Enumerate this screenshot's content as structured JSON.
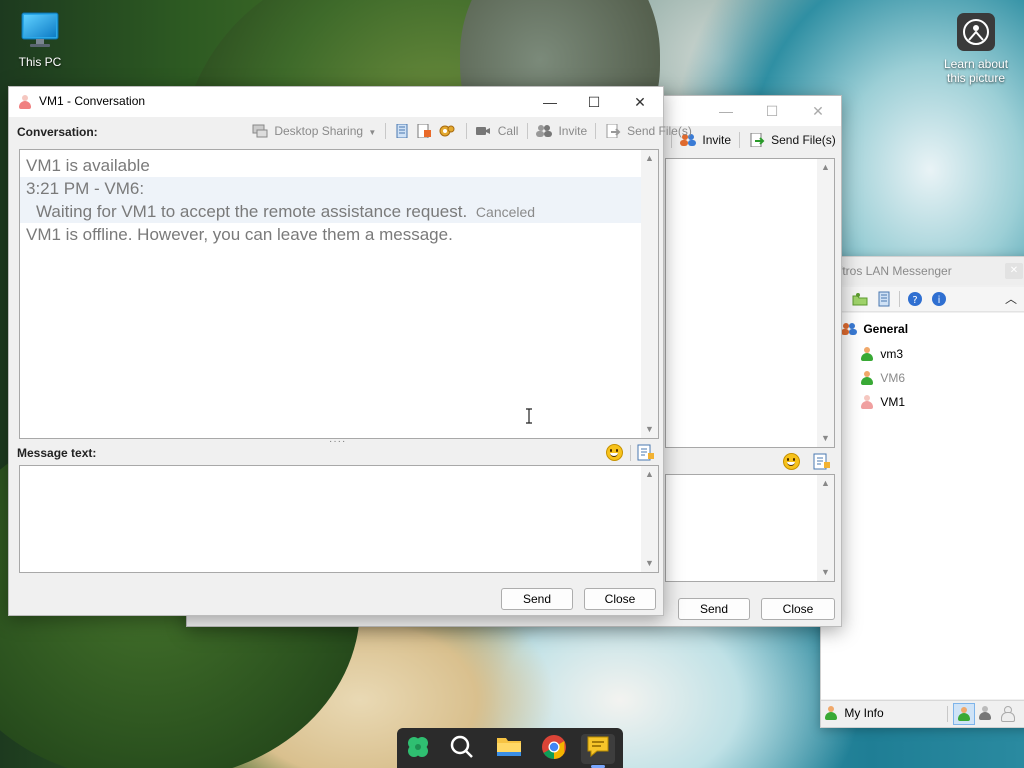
{
  "desktop": {
    "this_pc_label": "This PC",
    "learn_label_line1": "Learn about",
    "learn_label_line2": "this picture",
    "my_info_label": "My Info"
  },
  "conv_window": {
    "title": "VM1 - Conversation",
    "conversation_label": "Conversation:",
    "toolbar": {
      "desktop_sharing": "Desktop Sharing",
      "call": "Call",
      "invite": "Invite",
      "send_files": "Send File(s)"
    },
    "messages": [
      {
        "text": "VM1 is available"
      },
      {
        "text": "3:21 PM - VM6:"
      },
      {
        "text": "Waiting for VM1 to accept the remote assistance request.",
        "status": "Canceled"
      },
      {
        "text": "VM1 is offline. However, you can leave them a message."
      }
    ],
    "message_text_label": "Message text:",
    "message_input_value": "",
    "send_button": "Send",
    "close_button": "Close"
  },
  "bg_conv_window": {
    "toolbar_partial": "ll",
    "invite": "Invite",
    "send_files": "Send File(s)",
    "send_button": "Send",
    "close_button": "Close"
  },
  "messenger": {
    "title": "ftros LAN Messenger",
    "group_name": "General",
    "contacts": [
      {
        "name": "vm3",
        "status_color": "#39a935"
      },
      {
        "name": "VM6",
        "status_color": "#39a935"
      },
      {
        "name": "VM1",
        "status_color": "#e04040"
      }
    ]
  },
  "colors": {
    "available": "#39a935",
    "offline": "#e04040"
  }
}
